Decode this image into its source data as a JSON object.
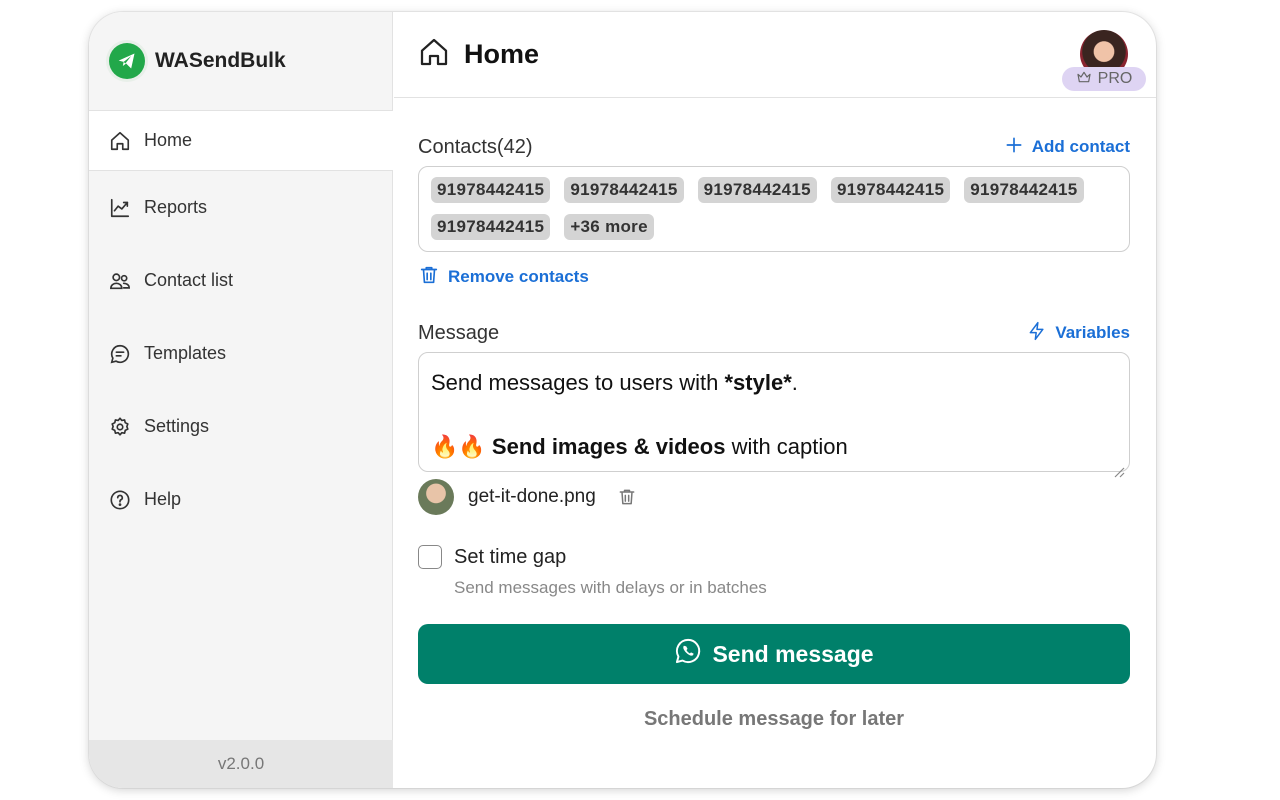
{
  "brand": {
    "name": "WASendBulk",
    "accent": "#22a84a"
  },
  "sidebar": {
    "items": [
      {
        "label": "Home",
        "icon": "home-icon",
        "active": true
      },
      {
        "label": "Reports",
        "icon": "chart-icon"
      },
      {
        "label": "Contact list",
        "icon": "users-icon"
      },
      {
        "label": "Templates",
        "icon": "message-icon"
      },
      {
        "label": "Settings",
        "icon": "gear-icon"
      },
      {
        "label": "Help",
        "icon": "help-icon"
      }
    ],
    "version": "v2.0.0"
  },
  "header": {
    "title": "Home",
    "badge": "PRO",
    "badge_color": "#ded4f3"
  },
  "contacts": {
    "label": "Contacts(42)",
    "add_label": "Add contact",
    "chips": [
      "91978442415",
      "91978442415",
      "91978442415",
      "91978442415",
      "91978442415",
      "91978442415",
      "+36 more"
    ],
    "remove_label": "Remove contacts"
  },
  "message": {
    "label": "Message",
    "variables_label": "Variables",
    "line1_pre": "Send messages to users with ",
    "line1_bold": "*style*",
    "line1_post": ".",
    "line2_emoji": "🔥🔥",
    "line2_bold": "Send images & videos",
    "line2_post": " with caption"
  },
  "attachment": {
    "file_name": "get-it-done.png"
  },
  "timegap": {
    "label": "Set time gap",
    "help": "Send messages with delays or in batches",
    "checked": false
  },
  "actions": {
    "send_label": "Send message",
    "schedule_label": "Schedule message for later",
    "send_color": "#00806a"
  },
  "link_color": "#1b6fd6"
}
